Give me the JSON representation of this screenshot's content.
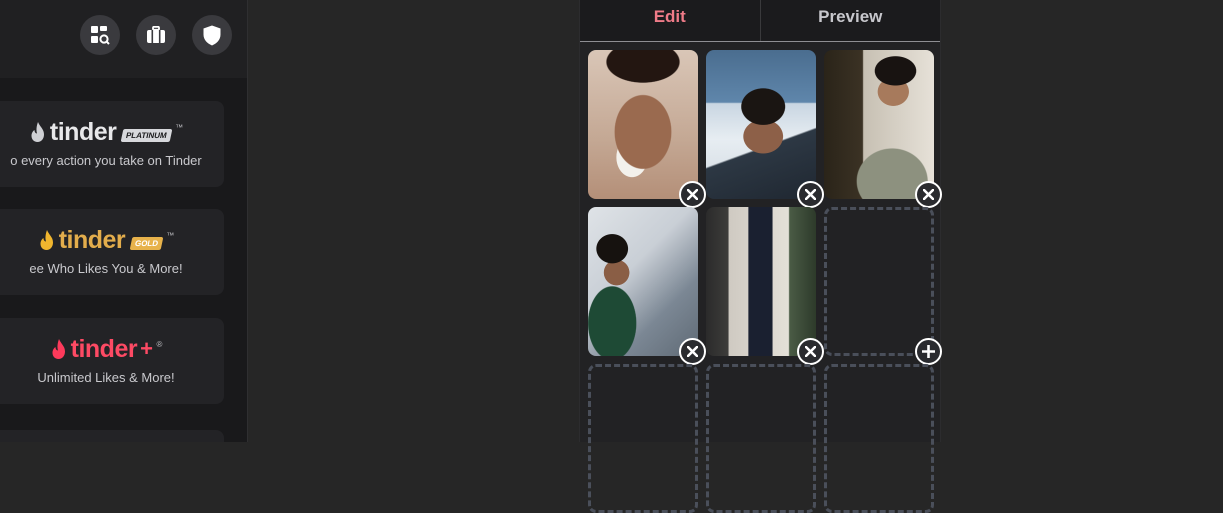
{
  "header": {
    "icons": [
      "explore-icon",
      "briefcase-icon",
      "shield-icon"
    ]
  },
  "subscriptions": [
    {
      "name": "tinder",
      "tag": "PLATINUM",
      "mark": "™",
      "description": "o every action you take on Tinder",
      "accent": "#e8e8ea"
    },
    {
      "name": "tinder",
      "tag": "GOLD",
      "mark": "™",
      "description": "ee Who Likes You & More!",
      "accent": "#e7b24b"
    },
    {
      "name": "tinder",
      "tag": "+",
      "mark": "®",
      "description": "Unlimited Likes & More!",
      "accent": "#fd3a5b"
    }
  ],
  "editor": {
    "tabs": [
      {
        "label": "Edit",
        "active": true
      },
      {
        "label": "Preview",
        "active": false
      }
    ],
    "active_tab_color": "#ef7b88",
    "inactive_tab_color": "#c7c7cc",
    "photos_filled": 5,
    "slots_total": 9
  }
}
